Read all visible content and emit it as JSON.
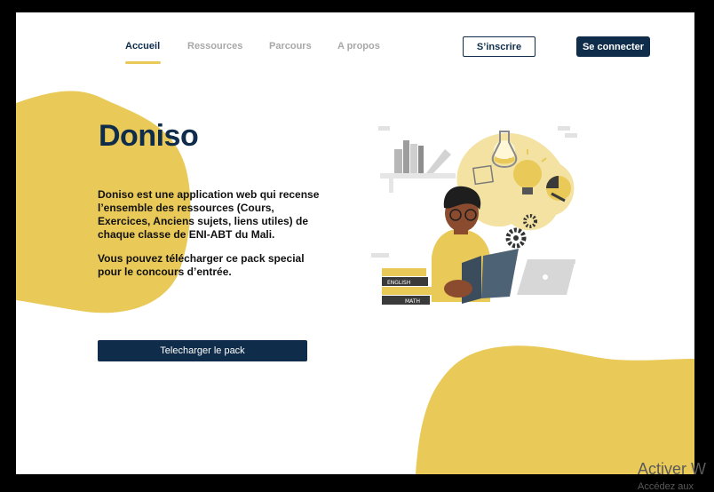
{
  "nav": {
    "items": [
      {
        "label": "Accueil",
        "active": true
      },
      {
        "label": "Ressources",
        "active": false
      },
      {
        "label": "Parcours",
        "active": false
      },
      {
        "label": "A propos",
        "active": false
      }
    ],
    "signup_label": "S’inscrire",
    "login_label": "Se connecter"
  },
  "hero": {
    "title": "Doniso",
    "description": "Doniso est une application web qui recense l’ensemble des ressources (Cours, Exercices, Anciens sujets, liens utiles) de chaque classe de ENI-ABT du Mali.",
    "note": "Vous pouvez télécharger ce pack special pour le concours d’entrée.",
    "cta_label": "Telecharger le pack"
  },
  "illustration": {
    "book_labels": [
      "ENGLISH",
      "MATH"
    ]
  },
  "watermark": {
    "line1": "Activer W",
    "line2": "Accédez aux"
  },
  "colors": {
    "navy": "#0f2d4a",
    "yellow": "#e9c957",
    "muted_nav": "#a8a8a8",
    "background": "#ffffff"
  }
}
